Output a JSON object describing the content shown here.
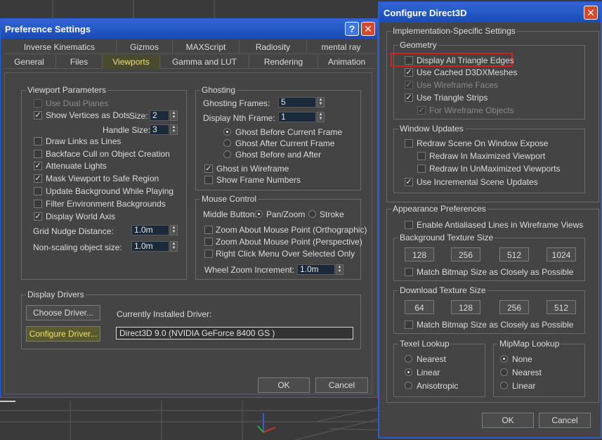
{
  "preferences": {
    "title": "Preference Settings",
    "tabs_row1": [
      "Inverse Kinematics",
      "Gizmos",
      "MAXScript",
      "Radiosity",
      "mental ray"
    ],
    "tabs_row2": [
      "General",
      "Files",
      "Viewports",
      "Gamma and LUT",
      "Rendering",
      "Animation"
    ],
    "viewport_params": {
      "title": "Viewport Parameters",
      "use_dual_planes": "Use Dual Planes",
      "show_vertices": "Show Vertices as Dots",
      "size_label": "Size:",
      "size_value": "2",
      "handle_size_label": "Handle Size:",
      "handle_size_value": "3",
      "draw_links": "Draw Links as Lines",
      "backface_cull": "Backface Cull on Object Creation",
      "attenuate_lights": "Attenuate Lights",
      "mask_viewport": "Mask Viewport to Safe Region",
      "update_background": "Update Background While Playing",
      "filter_env": "Filter Environment Backgrounds",
      "display_world_axis": "Display World Axis",
      "grid_nudge_label": "Grid Nudge Distance:",
      "grid_nudge_value": "1.0m",
      "non_scaling_label": "Non-scaling object size:",
      "non_scaling_value": "1.0m"
    },
    "ghosting": {
      "title": "Ghosting",
      "frames_label": "Ghosting Frames:",
      "frames_value": "5",
      "nth_label": "Display Nth Frame:",
      "nth_value": "1",
      "before": "Ghost Before Current Frame",
      "after": "Ghost After Current Frame",
      "before_after": "Ghost Before and After",
      "in_wireframe": "Ghost in Wireframe",
      "show_frame_numbers": "Show Frame Numbers"
    },
    "mouse_control": {
      "title": "Mouse Control",
      "middle_button_label": "Middle Button:",
      "pan_zoom": "Pan/Zoom",
      "stroke": "Stroke",
      "zoom_ortho": "Zoom About Mouse Point (Orthographic)",
      "zoom_persp": "Zoom About Mouse Point (Perspective)",
      "right_click": "Right Click Menu Over Selected Only",
      "wheel_zoom_label": "Wheel Zoom Increment:",
      "wheel_zoom_value": "1.0m"
    },
    "display_drivers": {
      "title": "Display Drivers",
      "choose_driver": "Choose Driver...",
      "configure_driver": "Configure Driver...",
      "current_label": "Currently Installed Driver:",
      "current_value": "Direct3D 9.0 (NVIDIA GeForce 8400 GS )"
    },
    "ok": "OK",
    "cancel": "Cancel"
  },
  "direct3d": {
    "title": "Configure Direct3D",
    "impl_title": "Implementation-Specific Settings",
    "geometry": {
      "title": "Geometry",
      "display_all_edges": "Display All Triangle Edges",
      "use_cached": "Use Cached D3DXMeshes",
      "use_wireframe_faces": "Use Wireframe Faces",
      "use_triangle_strips": "Use Triangle Strips",
      "for_wireframe_objects": "For Wireframe Objects"
    },
    "window_updates": {
      "title": "Window Updates",
      "redraw_expose": "Redraw Scene On Window Expose",
      "redraw_maximized": "Redraw In Maximized Viewport",
      "redraw_unmaximized": "Redraw In UnMaximized Viewports",
      "incremental": "Use Incremental Scene Updates"
    },
    "appearance": {
      "title": "Appearance Preferences",
      "antialiased": "Enable Antialiased Lines in Wireframe Views",
      "bg_texture_title": "Background Texture Size",
      "bg_sizes": [
        "128",
        "256",
        "512",
        "1024"
      ],
      "bg_match": "Match Bitmap Size as Closely as Possible",
      "dl_texture_title": "Download Texture Size",
      "dl_sizes": [
        "64",
        "128",
        "256",
        "512"
      ],
      "dl_match": "Match Bitmap Size as Closely as Possible",
      "texel_title": "Texel Lookup",
      "texel_nearest": "Nearest",
      "texel_linear": "Linear",
      "texel_aniso": "Anisotropic",
      "mipmap_title": "MipMap Lookup",
      "mip_none": "None",
      "mip_nearest": "Nearest",
      "mip_linear": "Linear"
    },
    "ok": "OK",
    "cancel": "Cancel"
  },
  "colors": {
    "titlebar": "#1a4bb8",
    "highlight_yellow": "#e8e07a",
    "red_outline": "#d42020"
  }
}
